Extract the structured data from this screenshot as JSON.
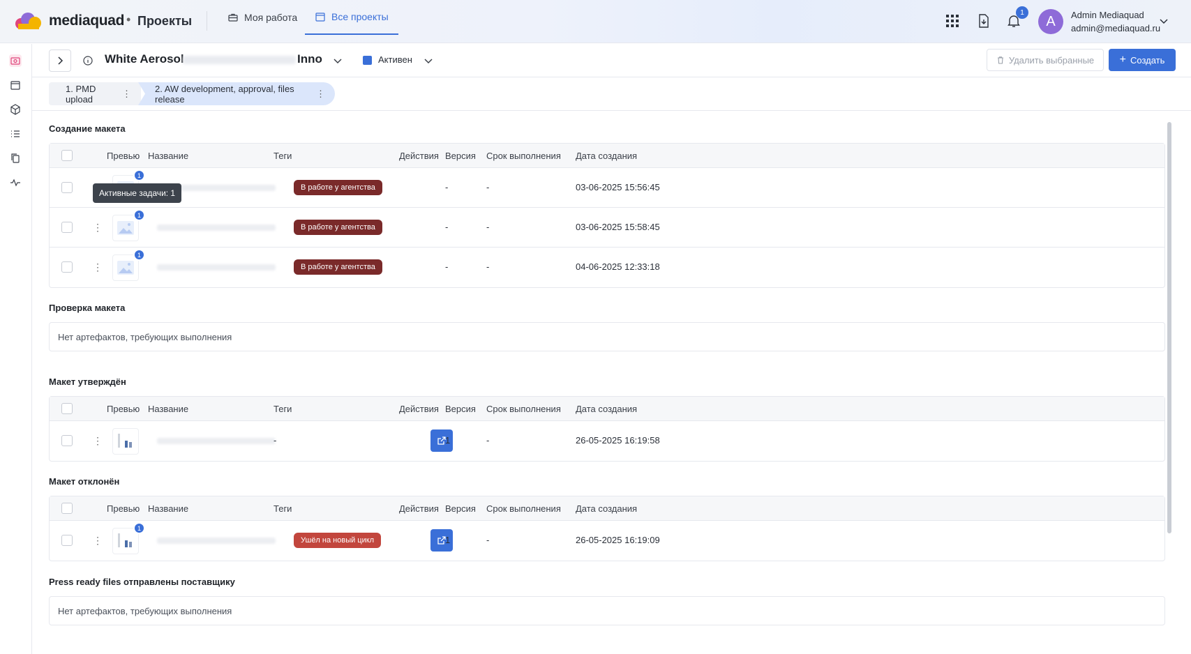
{
  "brand": {
    "name": "mediaquad",
    "dot": "•",
    "section": "Проекты"
  },
  "nav": {
    "tabs": [
      {
        "label": "Моя работа"
      },
      {
        "label": "Все проекты"
      }
    ]
  },
  "header": {
    "bell_count": "1",
    "avatar_letter": "A",
    "user_name": "Admin Mediaquad",
    "user_email": "admin@mediaquad.ru"
  },
  "project": {
    "title_start": "White Aerosol",
    "title_end": "Inno",
    "status": "Активен",
    "status_color": "#3a6fd8",
    "delete_label": "Удалить выбранные",
    "create_label": "Создать"
  },
  "stages": [
    {
      "label": "1. PMD upload"
    },
    {
      "label": "2. AW development, approval, files release"
    }
  ],
  "columns": {
    "preview": "Превью",
    "name": "Название",
    "tags": "Теги",
    "actions": "Действия",
    "version": "Версия",
    "deadline": "Срок выполнения",
    "created": "Дата создания"
  },
  "tooltip": "Активные задачи: 1",
  "sections": {
    "s1": {
      "title": "Создание макета",
      "rows": [
        {
          "badge": "1",
          "tag": "В работе у агентства",
          "version": "-",
          "deadline": "-",
          "created": "03-06-2025 15:56:45"
        },
        {
          "badge": "1",
          "tag": "В работе у агентства",
          "version": "-",
          "deadline": "-",
          "created": "03-06-2025 15:58:45"
        },
        {
          "badge": "1",
          "tag": "В работе у агентства",
          "version": "-",
          "deadline": "-",
          "created": "04-06-2025 12:33:18"
        }
      ]
    },
    "s2": {
      "title": "Проверка макета",
      "empty": "Нет артефактов, требующих выполнения"
    },
    "s3": {
      "title": "Макет утверждён",
      "rows": [
        {
          "tag": "-",
          "version": "1",
          "deadline": "-",
          "created": "26-05-2025 16:19:58"
        }
      ]
    },
    "s4": {
      "title": "Макет отклонён",
      "rows": [
        {
          "badge": "1",
          "tag": "Ушёл на новый цикл",
          "version": "1",
          "deadline": "-",
          "created": "26-05-2025 16:19:09"
        }
      ]
    },
    "s5": {
      "title": "Press ready files отправлены поставщику",
      "empty": "Нет артефактов, требующих выполнения"
    }
  },
  "colors": {
    "accent": "#3a6fd8",
    "tag_dark": "#7a2a2a",
    "tag_red": "#c2463d",
    "avatar": "#8e6bd8"
  }
}
